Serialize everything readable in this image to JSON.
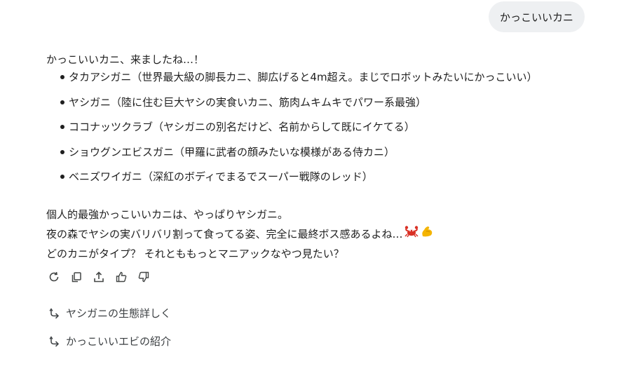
{
  "user_message": "かっこいいカニ",
  "reply": {
    "intro": "かっこいいカニ、来ましたね…！",
    "items": [
      "タカアシガニ（世界最大級の脚長カニ、脚広げると4m超え。まじでロボットみたいにかっこいい）",
      "ヤシガニ（陸に住む巨大ヤシの実食いカニ、筋肉ムキムキでパワー系最強）",
      "ココナッツクラブ（ヤシガニの別名だけど、名前からして既にイケてる）",
      "ショウグンエビスガニ（甲羅に武者の顔みたいな模様がある侍カニ）",
      "ベニズワイガニ（深紅のボディでまるでスーパー戦隊のレッド）"
    ],
    "summary_line1": "個人的最強かっこいいカニは、やっぱりヤシガニ。",
    "summary_line2": "夜の森でヤシの実バリバリ割って食ってる姿、完全に最終ボス感あるよね…",
    "summary_line3": "どのカニがタイプ？ それとももっとマニアックなやつ見たい？",
    "emojis": [
      "crab-emoji",
      "flexed-biceps-emoji"
    ]
  },
  "actions": [
    "regenerate-icon",
    "copy-icon",
    "share-icon",
    "thumbs-up-icon",
    "thumbs-down-icon"
  ],
  "suggestions": [
    "ヤシガニの生態詳しく",
    "かっこいいエビの紹介"
  ],
  "colors": {
    "user_bubble_bg": "#eef0f2",
    "text": "#1f1f1f",
    "icon": "#444746",
    "crab": "#d93025",
    "biceps": "#f4b400"
  }
}
